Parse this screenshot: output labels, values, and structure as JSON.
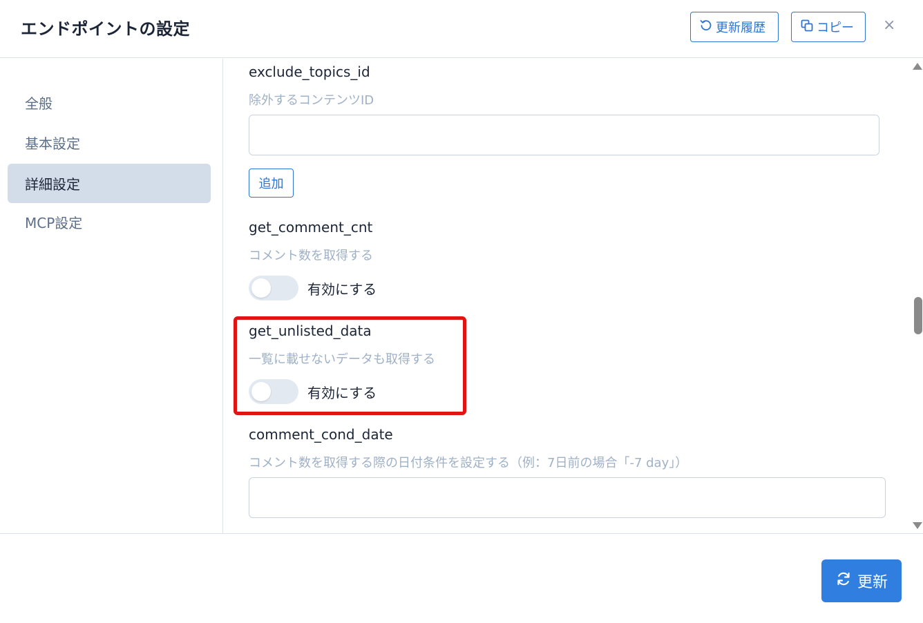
{
  "header": {
    "title": "エンドポイントの設定",
    "history_label": "更新履歴",
    "copy_label": "コピー",
    "close_symbol": "×"
  },
  "sidebar": {
    "items": [
      {
        "label": "全般",
        "active": false
      },
      {
        "label": "基本設定",
        "active": false
      },
      {
        "label": "詳細設定",
        "active": true
      },
      {
        "label": "MCP設定",
        "active": false
      }
    ]
  },
  "fields": {
    "exclude_topics_id": {
      "label": "exclude_topics_id",
      "description": "除外するコンテンツID",
      "value": "",
      "add_label": "追加"
    },
    "get_comment_cnt": {
      "label": "get_comment_cnt",
      "description": "コメント数を取得する",
      "toggle_label": "有効にする",
      "enabled": false
    },
    "get_unlisted_data": {
      "label": "get_unlisted_data",
      "description": "一覧に載せないデータも取得する",
      "toggle_label": "有効にする",
      "enabled": false,
      "highlighted": true
    },
    "comment_cond_date": {
      "label": "comment_cond_date",
      "description": "コメント数を取得する際の日付条件を設定する（例：7日前の場合「-7 day」）",
      "value": ""
    }
  },
  "footer": {
    "update_label": "更新"
  },
  "colors": {
    "accent": "#2f74d0",
    "primary_button": "#2f7ee0",
    "highlight_border": "#e01414",
    "active_nav_bg": "#d2dde9"
  },
  "icons": {
    "history": "history-icon",
    "copy": "copy-icon",
    "close": "close-icon",
    "refresh": "refresh-icon"
  }
}
